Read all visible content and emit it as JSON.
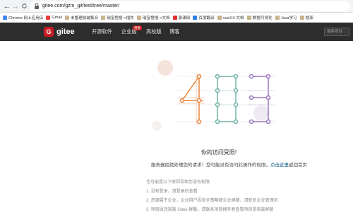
{
  "browser": {
    "back": "←",
    "forward": "→",
    "reload": "C",
    "url": "gitee.com/gzm_git/test/tree/master/"
  },
  "bookmarks": [
    {
      "label": "Chrome 网上应用店",
      "color": "#4285f4"
    },
    {
      "label": "Gmail",
      "color": "#ea4335"
    },
    {
      "label": "未整理前端集合",
      "color": "#c8b38a"
    },
    {
      "label": "瑞宝悟悟->插件",
      "color": "#c8b38a"
    },
    {
      "label": "瑞宝悟悟->文档",
      "color": "#c8b38a"
    },
    {
      "label": "慕课网",
      "color": "#e5302e"
    },
    {
      "label": "百度翻译",
      "color": "#2d7ee6"
    },
    {
      "label": "vue3.0-文档",
      "color": "#c8b38a"
    },
    {
      "label": "数据可视化",
      "color": "#c8b38a"
    },
    {
      "label": "Java学习",
      "color": "#c8b38a"
    },
    {
      "label": "框架",
      "color": "#c8b38a"
    }
  ],
  "header": {
    "logo_mark": "G",
    "logo_text": "gitee",
    "nav": [
      "开源软件",
      "企业版",
      "高校版",
      "博客"
    ],
    "badge": "特惠",
    "search_placeholder": "搜索项目"
  },
  "illustration": {
    "digits": "403",
    "colors": {
      "four": "#e8833a",
      "zero": "#6fb3a6",
      "three": "#9b76c0"
    }
  },
  "main": {
    "title": "你的访问受限!",
    "sub_prefix": "服务器拒绝处理您的请求！您可能没有访问此操作的权限。",
    "sub_link": "点击这里",
    "sub_suffix": "返回首页",
    "reasons_title": "也可能是以下原因导致您没有权限",
    "reasons": [
      "1. 没有登录，请登录后查看",
      "2. 资源属于企业，企业用户因安全策略被企业屏蔽，请联系企业管理员",
      "3. 项目因违规被 Gitee 屏蔽，请联系项目拥有者查看项目是否被屏蔽"
    ]
  }
}
